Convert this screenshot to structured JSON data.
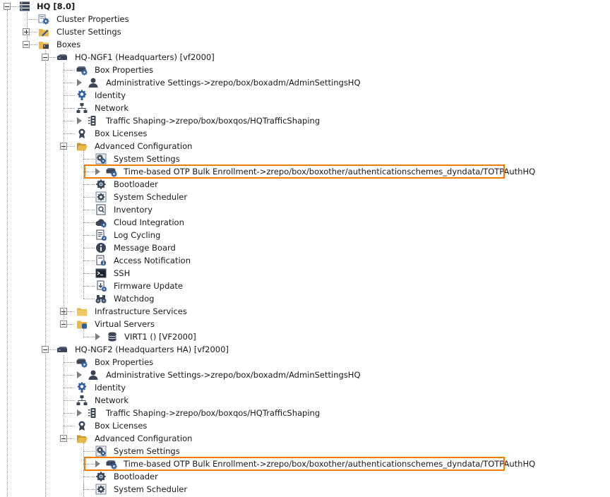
{
  "tree": {
    "root": {
      "label": "HQ [8.0]",
      "icon": "server-rack-icon"
    },
    "cluster_properties": {
      "label": "Cluster Properties",
      "icon": "cluster-properties-icon"
    },
    "cluster_settings": {
      "label": "Cluster Settings",
      "icon": "cluster-settings-folder-icon"
    },
    "boxes": {
      "label": "Boxes",
      "icon": "boxes-folder-icon"
    },
    "box1": {
      "label": "HQ-NGF1 (Headquarters) [vf2000]",
      "icon": "box-device-icon",
      "items": [
        {
          "label": "Box Properties",
          "icon": "box-properties-icon"
        },
        {
          "label": "Administrative Settings->zrepo/box/boxadm/AdminSettingsHQ",
          "icon": "user-icon",
          "linked": true
        },
        {
          "label": "Identity",
          "icon": "identity-gear-icon"
        },
        {
          "label": "Network",
          "icon": "network-icon"
        },
        {
          "label": "Traffic Shaping->zrepo/box/boxqos/HQTrafficShaping",
          "icon": "traffic-shaping-icon",
          "linked": true
        },
        {
          "label": "Box Licenses",
          "icon": "license-badge-icon"
        },
        {
          "label": "Advanced Configuration",
          "icon": "folder-open-icon"
        },
        {
          "label": "System Settings",
          "icon": "system-settings-icon"
        },
        {
          "label": "Time-based OTP Bulk Enrollment->zrepo/box/boxother/authenticationschemes_dyndata/TOTPAuthHQ",
          "icon": "box-properties-icon",
          "linked": true,
          "highlighted": true
        },
        {
          "label": "Bootloader",
          "icon": "bootloader-icon"
        },
        {
          "label": "System Scheduler",
          "icon": "scheduler-icon"
        },
        {
          "label": "Inventory",
          "icon": "inventory-icon"
        },
        {
          "label": "Cloud Integration",
          "icon": "cloud-icon"
        },
        {
          "label": "Log Cycling",
          "icon": "log-cycling-icon"
        },
        {
          "label": "Message Board",
          "icon": "info-icon"
        },
        {
          "label": "Access Notification",
          "icon": "access-notification-icon"
        },
        {
          "label": "SSH",
          "icon": "terminal-icon"
        },
        {
          "label": "Firmware Update",
          "icon": "firmware-update-icon"
        },
        {
          "label": "Watchdog",
          "icon": "binoculars-icon"
        },
        {
          "label": "Infrastructure Services",
          "icon": "folder-icon"
        },
        {
          "label": "Virtual Servers",
          "icon": "virtual-servers-folder-icon"
        },
        {
          "label": "VIRT1 () [VF2000]",
          "icon": "database-icon",
          "linked": true
        }
      ]
    },
    "box2": {
      "label": "HQ-NGF2 (Headquarters HA) [vf2000]",
      "icon": "box-device-icon",
      "items": [
        {
          "label": "Box Properties",
          "icon": "box-properties-icon"
        },
        {
          "label": "Administrative Settings->zrepo/box/boxadm/AdminSettingsHQ",
          "icon": "user-icon",
          "linked": true
        },
        {
          "label": "Identity",
          "icon": "identity-gear-icon"
        },
        {
          "label": "Network",
          "icon": "network-icon"
        },
        {
          "label": "Traffic Shaping->zrepo/box/boxqos/HQTrafficShaping",
          "icon": "traffic-shaping-icon",
          "linked": true
        },
        {
          "label": "Box Licenses",
          "icon": "license-badge-icon"
        },
        {
          "label": "Advanced Configuration",
          "icon": "folder-open-icon"
        },
        {
          "label": "System Settings",
          "icon": "system-settings-icon"
        },
        {
          "label": "Time-based OTP Bulk Enrollment->zrepo/box/boxother/authenticationschemes_dyndata/TOTPAuthHQ",
          "icon": "box-properties-icon",
          "linked": true,
          "highlighted": true
        },
        {
          "label": "Bootloader",
          "icon": "bootloader-icon"
        },
        {
          "label": "System Scheduler",
          "icon": "scheduler-icon"
        }
      ]
    }
  },
  "colors": {
    "highlight": "#f07d00",
    "guide": "#9a9a9a",
    "folder": "#e8b84a",
    "icon_blue": "#2f5f9e",
    "icon_dark": "#3a4657"
  }
}
